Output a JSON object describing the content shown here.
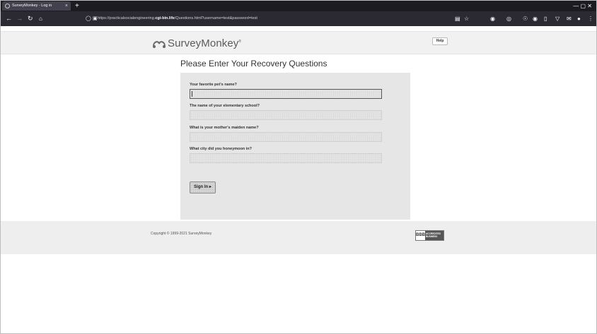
{
  "browser": {
    "tab_title": "SurveyMonkey - Log in",
    "tab_close": "×",
    "new_tab": "+",
    "url_prefix": "https://practicalsocialengineering.",
    "url_domain": "cgi-bin.life",
    "url_suffix": "/Questions.html?username=test&password=test",
    "window_controls": "—   ▢   ✕"
  },
  "header": {
    "logo_text": "SurveyMonkey",
    "logo_mark": "®",
    "help_label": "Help"
  },
  "form": {
    "title": "Please Enter Your Recovery Questions",
    "fields": [
      {
        "label": "Your favorite pet's name?",
        "value": ""
      },
      {
        "label": "The name of your elementary school?",
        "value": ""
      },
      {
        "label": "What is your mother's maiden name?",
        "value": ""
      },
      {
        "label": "What city did you honeymoon in?",
        "value": ""
      }
    ],
    "signin_label": "Sign In ▸"
  },
  "footer": {
    "copyright": "Copyright © 1999-2021 SurveyMonkey",
    "bbb_seal": "BBB",
    "bbb_text": "ACCREDITED BUSINESS"
  }
}
